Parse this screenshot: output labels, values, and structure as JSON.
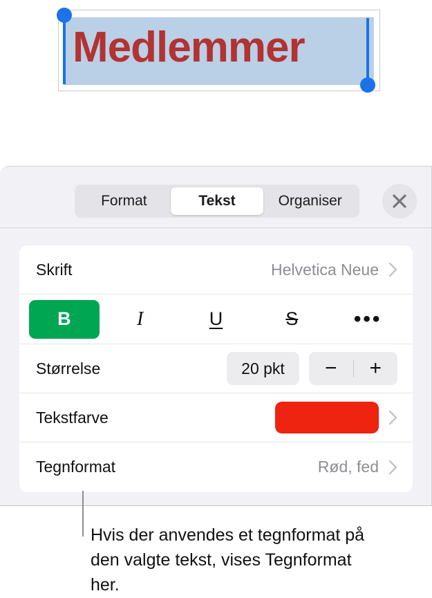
{
  "document": {
    "title_text": "Medlemmer",
    "title_color": "#b33232",
    "selection_highlight_color": "#b9d0e6",
    "handle_color": "#1a73e8"
  },
  "panel": {
    "tabs": [
      {
        "label": "Format",
        "active": false
      },
      {
        "label": "Tekst",
        "active": true
      },
      {
        "label": "Organiser",
        "active": false
      }
    ],
    "close_label": "×",
    "rows": {
      "font": {
        "label": "Skrift",
        "value": "Helvetica Neue"
      },
      "style": {
        "bold": "B",
        "italic": "I",
        "underline": "U",
        "strikethrough": "S",
        "more": "•••",
        "active_color": "#00a651"
      },
      "size": {
        "label": "Størrelse",
        "value": "20 pkt",
        "decrease": "−",
        "increase": "+"
      },
      "textcolor": {
        "label": "Tekstfarve",
        "swatch_color": "#ee2310"
      },
      "charstyle": {
        "label": "Tegnformat",
        "value": "Rød, fed"
      }
    }
  },
  "callout": {
    "text": "Hvis der anvendes et tegnformat på den valgte tekst, vises Tegnformat her."
  }
}
